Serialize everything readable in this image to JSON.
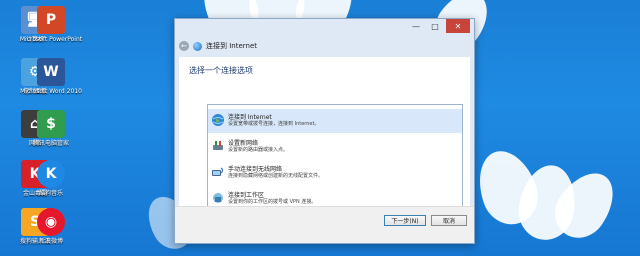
{
  "desktop": {
    "icons": [
      {
        "label": "计算机",
        "color": "#5b8fd0",
        "glyph": "🖥"
      },
      {
        "label": "Microsoft PowerPoint",
        "color": "#d24726",
        "glyph": "P"
      },
      {
        "label": "控制面板",
        "color": "#4aa3df",
        "glyph": "⚙"
      },
      {
        "label": "Microsoft Word 2010",
        "color": "#2b579a",
        "glyph": "W"
      },
      {
        "label": "网络",
        "color": "#3d3d3d",
        "glyph": "⌂"
      },
      {
        "label": "腾讯电脑管家",
        "color": "#2f9c4e",
        "glyph": "$"
      },
      {
        "label": "金山毒霸",
        "color": "#d6202a",
        "glyph": "K"
      },
      {
        "label": "酷狗音乐",
        "color": "#1e88e5",
        "glyph": "K"
      },
      {
        "label": "搜狗输入法",
        "color": "#f5a623",
        "glyph": "S"
      },
      {
        "label": "新浪微博",
        "color": "#e6162d",
        "glyph": "◉"
      }
    ]
  },
  "window": {
    "title": "连接到 Internet",
    "controls": {
      "minimize": "—",
      "maximize": "□",
      "close": "✕"
    },
    "back_glyph": "←",
    "heading": "选择一个连接选项",
    "options": [
      {
        "title": "连接到 Internet",
        "desc": "设置宽带或拨号连接，连接到 Internet。"
      },
      {
        "title": "设置新网络",
        "desc": "设置新的路由器或接入点。"
      },
      {
        "title": "手动连接到无线网络",
        "desc": "连接到隐藏网络或创建新的无线配置文件。"
      },
      {
        "title": "连接到工作区",
        "desc": "设置到你的工作区的拨号或 VPN 连接。"
      }
    ],
    "buttons": {
      "next": "下一步(N)",
      "cancel": "取消"
    }
  },
  "colors": {
    "accent": "#1f8ae2",
    "close": "#c7443a",
    "selected": "#d8e8fa"
  }
}
